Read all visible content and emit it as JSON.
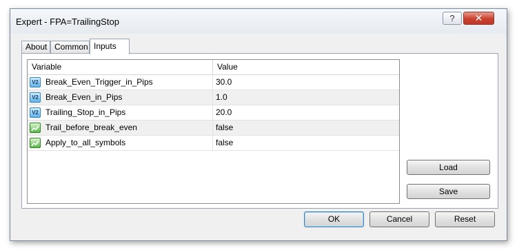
{
  "window": {
    "title": "Expert - FPA=TrailingStop",
    "help_glyph": "?",
    "close_glyph": "✕"
  },
  "tabs": [
    {
      "label": "About",
      "active": false
    },
    {
      "label": "Common",
      "active": false
    },
    {
      "label": "Inputs",
      "active": true
    }
  ],
  "grid": {
    "columns": [
      "Variable",
      "Value"
    ],
    "rows": [
      {
        "icon": "numeric-value-icon",
        "icon_text": "V2",
        "variable": "Break_Even_Trigger_in_Pips",
        "value": "30.0"
      },
      {
        "icon": "numeric-value-icon",
        "icon_text": "V2",
        "variable": "Break_Even_in_Pips",
        "value": "1.0"
      },
      {
        "icon": "numeric-value-icon",
        "icon_text": "V2",
        "variable": "Trailing_Stop_in_Pips",
        "value": "20.0"
      },
      {
        "icon": "boolean-value-icon",
        "icon_text": "",
        "variable": "Trail_before_break_even",
        "value": "false"
      },
      {
        "icon": "boolean-value-icon",
        "icon_text": "",
        "variable": "Apply_to_all_symbols",
        "value": "false"
      }
    ]
  },
  "side_buttons": {
    "load": "Load",
    "save": "Save"
  },
  "bottom_buttons": {
    "ok": "OK",
    "cancel": "Cancel",
    "reset": "Reset"
  },
  "colors": {
    "close_button": "#c9412c",
    "numeric_icon": "#5fb4ea",
    "boolean_icon": "#58b847",
    "default_button_border": "#3c7fb1"
  }
}
